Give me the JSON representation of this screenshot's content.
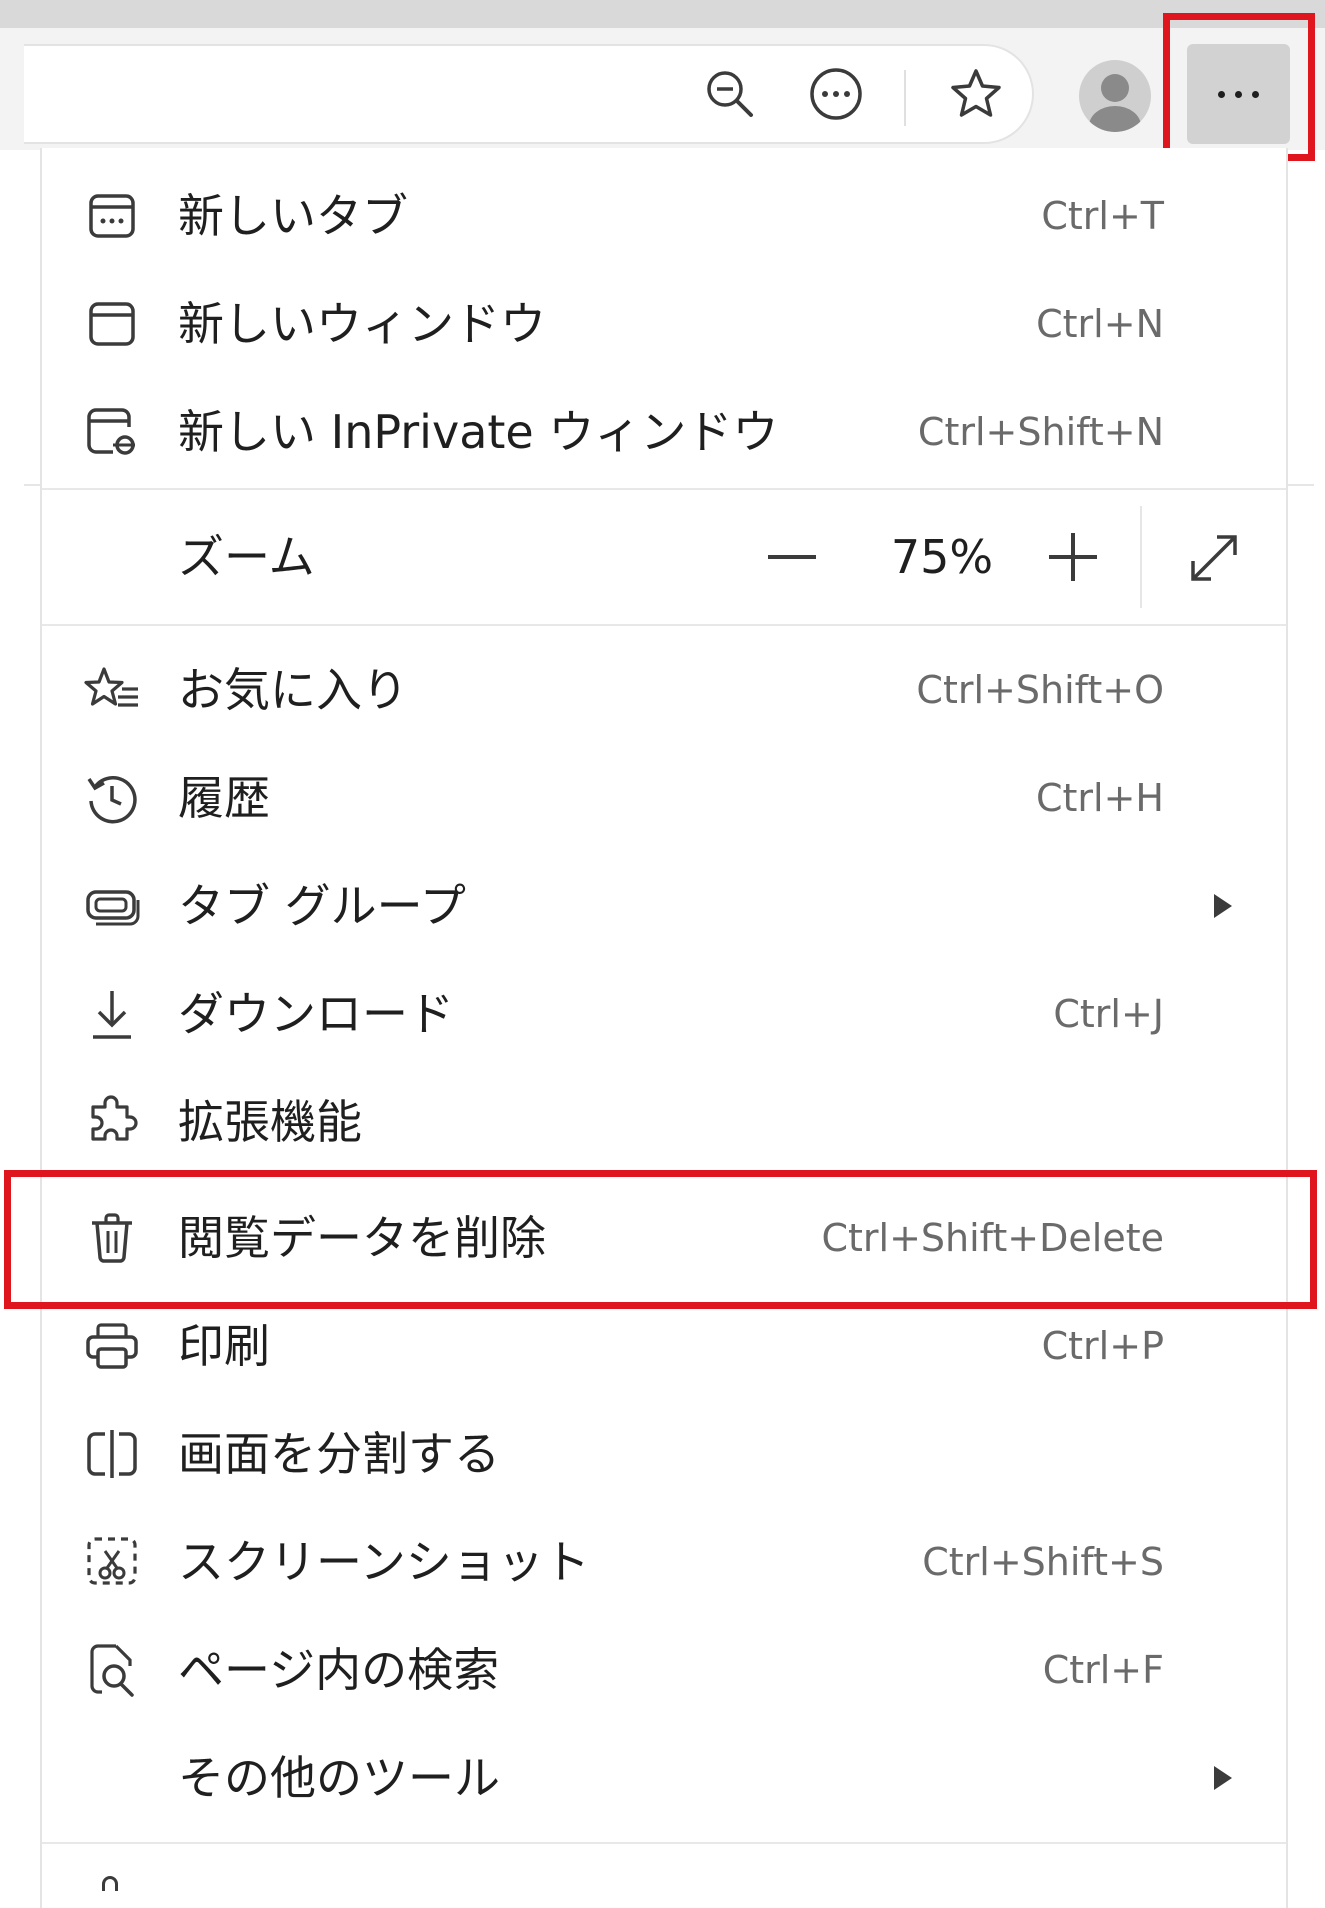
{
  "toolbar": {
    "zoom_out_icon": "zoom-out-icon",
    "read_aloud_icon": "more-circle-icon",
    "favorite_icon": "star-icon",
    "profile_icon": "avatar",
    "more_icon": "ellipsis-icon",
    "more_label": "···"
  },
  "menu": {
    "new_tab": {
      "label": "新しいタブ",
      "shortcut": "Ctrl+T"
    },
    "new_window": {
      "label": "新しいウィンドウ",
      "shortcut": "Ctrl+N"
    },
    "new_inprivate": {
      "label": "新しい InPrivate ウィンドウ",
      "shortcut": "Ctrl+Shift+N"
    },
    "zoom": {
      "label": "ズーム",
      "value": "75%"
    },
    "favorites": {
      "label": "お気に入り",
      "shortcut": "Ctrl+Shift+O"
    },
    "history": {
      "label": "履歴",
      "shortcut": "Ctrl+H"
    },
    "tab_groups": {
      "label": "タブ グループ"
    },
    "downloads": {
      "label": "ダウンロード",
      "shortcut": "Ctrl+J"
    },
    "extensions": {
      "label": "拡張機能"
    },
    "clear_data": {
      "label": "閲覧データを削除",
      "shortcut": "Ctrl+Shift+Delete"
    },
    "print": {
      "label": "印刷",
      "shortcut": "Ctrl+P"
    },
    "split_screen": {
      "label": "画面を分割する"
    },
    "screenshot": {
      "label": "スクリーンショット",
      "shortcut": "Ctrl+Shift+S"
    },
    "find_on_page": {
      "label": "ページ内の検索",
      "shortcut": "Ctrl+F"
    },
    "more_tools": {
      "label": "その他のツール"
    }
  },
  "colors": {
    "highlight": "#e0161f",
    "icon": "#3b3b3b",
    "shortcut_text": "#6a6a6a"
  }
}
